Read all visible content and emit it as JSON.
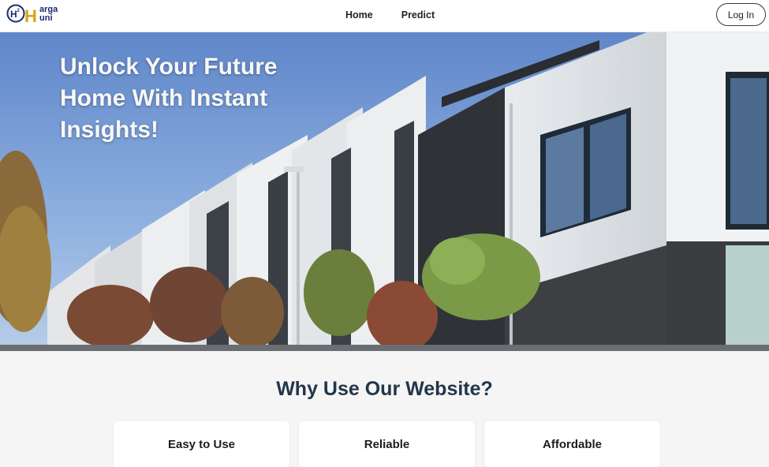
{
  "brand": {
    "logo_letters": "H",
    "logo_superscript": "2",
    "logo_line1": "arga",
    "logo_line2": "uni",
    "accent_color": "#1b2a6b",
    "gold_color": "#d4a514"
  },
  "nav": {
    "links": [
      {
        "label": "Home"
      },
      {
        "label": "Predict"
      }
    ],
    "login_label": "Log In"
  },
  "hero": {
    "title": "Unlock Your Future Home With Instant Insights!"
  },
  "why": {
    "title": "Why Use Our Website?",
    "cards": [
      {
        "title": "Easy to Use"
      },
      {
        "title": "Reliable"
      },
      {
        "title": "Affordable"
      }
    ]
  }
}
